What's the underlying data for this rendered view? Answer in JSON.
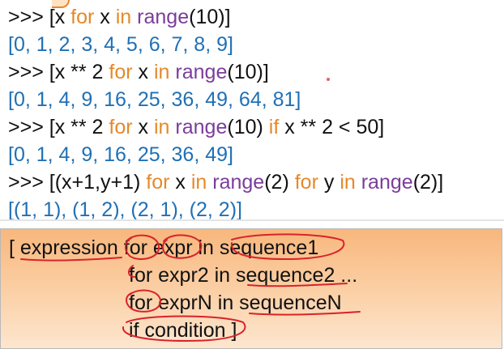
{
  "console": {
    "lines": [
      {
        "kind": "input",
        "tokens": [
          {
            "type": "prompt",
            "text": ">>> "
          },
          {
            "type": "plain",
            "text": "[x "
          },
          {
            "type": "keyword",
            "text": "for"
          },
          {
            "type": "plain",
            "text": " x "
          },
          {
            "type": "keyword",
            "text": "in"
          },
          {
            "type": "plain",
            "text": " "
          },
          {
            "type": "builtin",
            "text": "range"
          },
          {
            "type": "plain",
            "text": "(10)]"
          }
        ]
      },
      {
        "kind": "output",
        "tokens": [
          {
            "type": "output",
            "text": "[0, 1, 2, 3, 4, 5, 6, 7, 8, 9]"
          }
        ]
      },
      {
        "kind": "input",
        "tokens": [
          {
            "type": "prompt",
            "text": ">>> "
          },
          {
            "type": "plain",
            "text": "[x ** 2 "
          },
          {
            "type": "keyword",
            "text": "for"
          },
          {
            "type": "plain",
            "text": " x "
          },
          {
            "type": "keyword",
            "text": "in"
          },
          {
            "type": "plain",
            "text": " "
          },
          {
            "type": "builtin",
            "text": "range"
          },
          {
            "type": "plain",
            "text": "(10)]"
          }
        ]
      },
      {
        "kind": "output",
        "tokens": [
          {
            "type": "output",
            "text": "[0, 1, 4, 9, 16, 25, 36, 49, 64, 81]"
          }
        ]
      },
      {
        "kind": "input",
        "tokens": [
          {
            "type": "prompt",
            "text": ">>> "
          },
          {
            "type": "plain",
            "text": "[x ** 2 "
          },
          {
            "type": "keyword",
            "text": "for"
          },
          {
            "type": "plain",
            "text": " x "
          },
          {
            "type": "keyword",
            "text": "in"
          },
          {
            "type": "plain",
            "text": " "
          },
          {
            "type": "builtin",
            "text": "range"
          },
          {
            "type": "plain",
            "text": "(10) "
          },
          {
            "type": "keyword",
            "text": "if"
          },
          {
            "type": "plain",
            "text": " x ** 2 < 50]"
          }
        ]
      },
      {
        "kind": "output",
        "tokens": [
          {
            "type": "output",
            "text": "[0, 1, 4, 9, 16, 25, 36, 49]"
          }
        ]
      },
      {
        "kind": "input",
        "tokens": [
          {
            "type": "prompt",
            "text": ">>> "
          },
          {
            "type": "plain",
            "text": "[(x+1,y+1) "
          },
          {
            "type": "keyword",
            "text": "for"
          },
          {
            "type": "plain",
            "text": " x "
          },
          {
            "type": "keyword",
            "text": "in"
          },
          {
            "type": "plain",
            "text": " "
          },
          {
            "type": "builtin",
            "text": "range"
          },
          {
            "type": "plain",
            "text": "(2) "
          },
          {
            "type": "keyword",
            "text": "for"
          },
          {
            "type": "plain",
            "text": " y "
          },
          {
            "type": "keyword",
            "text": "in"
          },
          {
            "type": "plain",
            "text": " "
          },
          {
            "type": "builtin",
            "text": "range"
          },
          {
            "type": "plain",
            "text": "(2)]"
          }
        ]
      },
      {
        "kind": "output",
        "tokens": [
          {
            "type": "output",
            "text": "[(1, 1), (1, 2), (2, 1), (2, 2)]"
          }
        ]
      }
    ]
  },
  "syntax_box": {
    "line1": {
      "bracket": "[ ",
      "expression": "expression",
      "for": "for",
      "expr": "expr",
      "in": " in ",
      "sequence": "sequence1"
    },
    "line2": {
      "for": "for",
      "rest": " expr2 in ",
      "sequence": "sequence2",
      "ellipsis": " ..."
    },
    "line3": {
      "for": "for",
      "rest": " exprN in ",
      "sequence": "sequenceN"
    },
    "line4": {
      "condition": "if condition",
      "close": " ]"
    }
  },
  "colors": {
    "prompt_text": "#111111",
    "keyword": "#e5892a",
    "builtin": "#7b3d9b",
    "output": "#1f70b5",
    "annotation_ink": "#d8232a",
    "box_top": "#f8b77d",
    "box_bottom": "#fde6cf"
  },
  "icons": {
    "annotation": "hand-drawn-red-ink-markup"
  }
}
